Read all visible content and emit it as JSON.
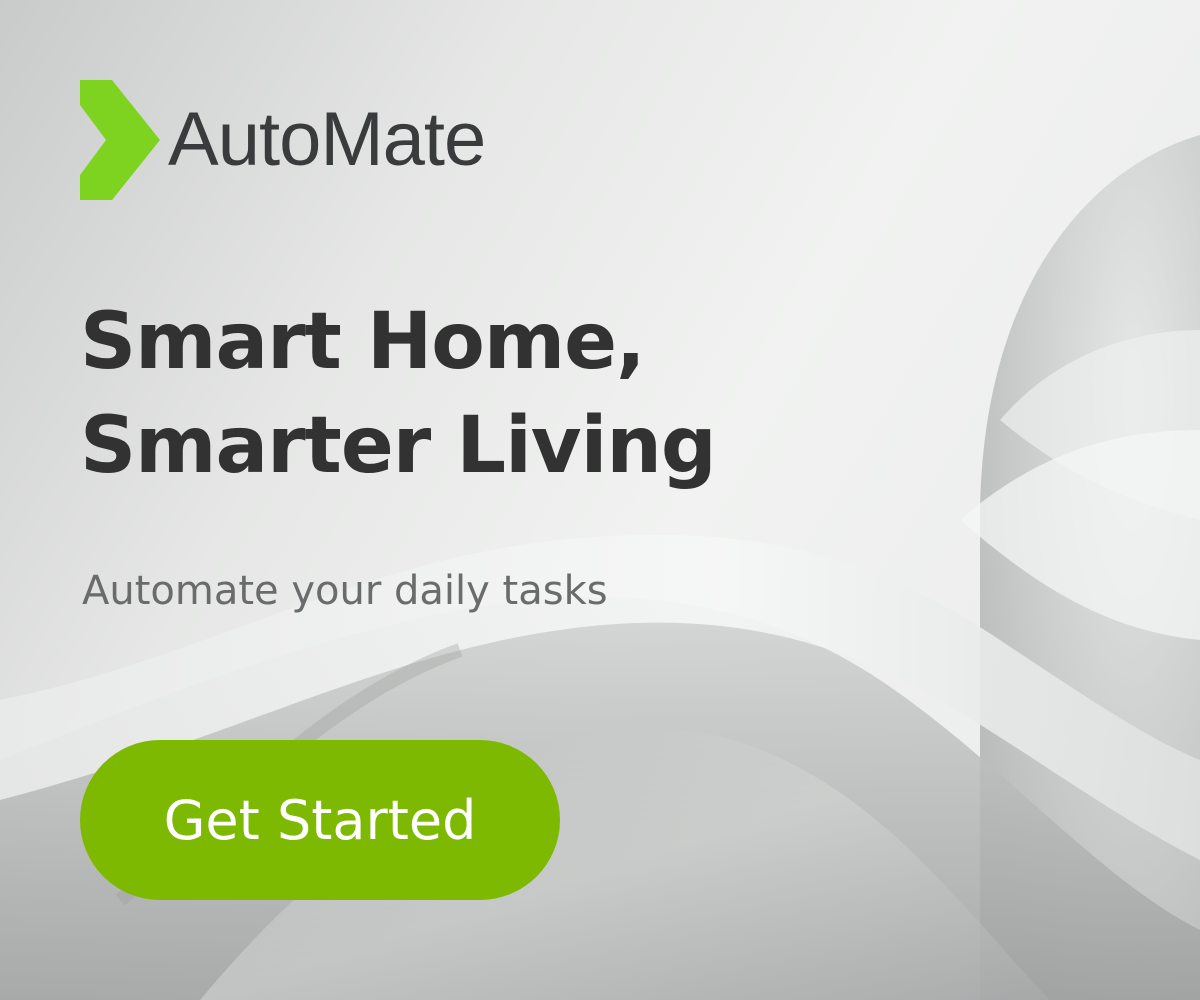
{
  "brand": {
    "name": "AutoMate",
    "accent_color": "#7ed321",
    "logo_icon": "chevron-right-icon"
  },
  "hero": {
    "headline_line1": "Smart Home,",
    "headline_line2": "Smarter Living",
    "subtitle": "Automate your daily tasks"
  },
  "cta": {
    "label": "Get Started",
    "color": "#7cb900"
  },
  "background": {
    "description_icon": "abstract-waves-background"
  }
}
